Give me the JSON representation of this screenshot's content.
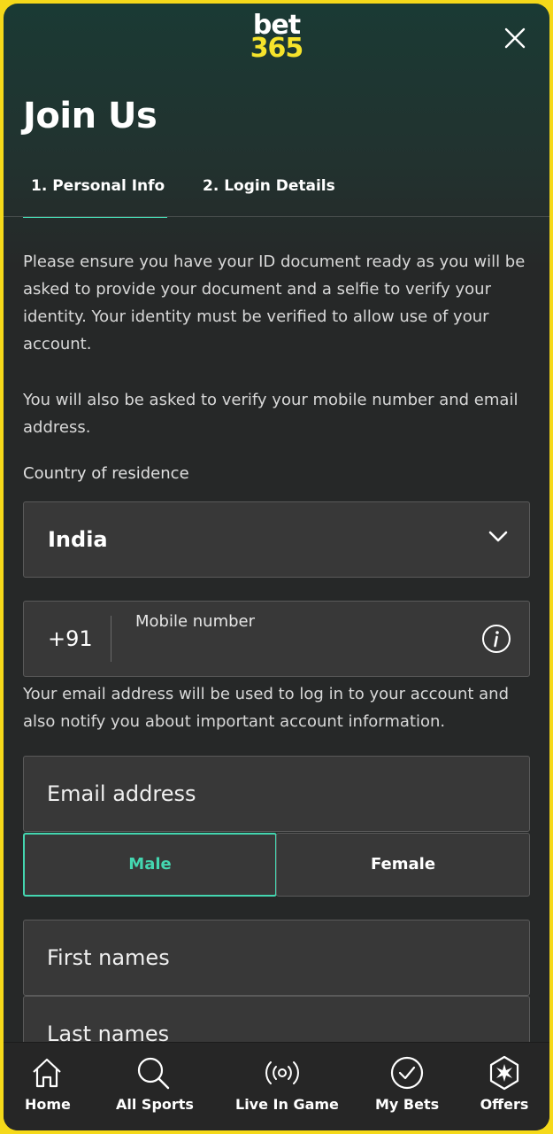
{
  "brand": {
    "line1": "bet",
    "line2": "365"
  },
  "header": {
    "title": "Join Us"
  },
  "tabs": [
    {
      "label": "1.  Personal Info",
      "active": true
    },
    {
      "label": "2.  Login Details",
      "active": false
    }
  ],
  "intro": {
    "p1": "Please ensure you have your ID document ready as you will be asked to provide your document and a selfie to verify your identity. Your identity must be verified to allow use of your account.",
    "p2": "You will also be asked to verify your mobile number and email address."
  },
  "country": {
    "label": "Country of residence",
    "value": "India"
  },
  "mobile": {
    "code": "+91",
    "placeholder": "Mobile number"
  },
  "email_note": "Your email address will be used to log in to your account and also notify you about important account information.",
  "email": {
    "placeholder": "Email address"
  },
  "gender": {
    "male": "Male",
    "female": "Female",
    "selected": "Male"
  },
  "names": {
    "first_placeholder": "First names",
    "last_placeholder": "Last names"
  },
  "nav": [
    {
      "label": "Home",
      "icon": "home-icon"
    },
    {
      "label": "All Sports",
      "icon": "search-icon"
    },
    {
      "label": "Live In Game",
      "icon": "live-broadcast-icon"
    },
    {
      "label": "My Bets",
      "icon": "check-circle-icon"
    },
    {
      "label": "Offers",
      "icon": "offers-badge-icon"
    }
  ],
  "colors": {
    "accent": "#44d6b0",
    "brand_yellow": "#f5e32b",
    "background": "#262828"
  }
}
